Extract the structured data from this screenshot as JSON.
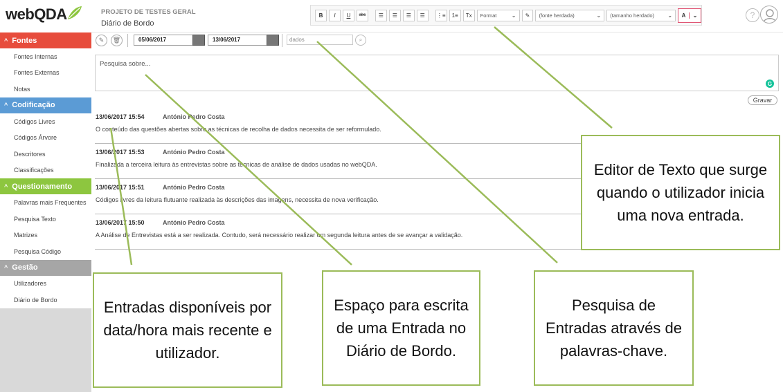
{
  "app": {
    "logo_web": "web",
    "logo_qda": "QDA"
  },
  "colors": {
    "fontes": "#e74c3c",
    "codificacao": "#5b9bd5",
    "questionamento": "#8dc63f",
    "gestao": "#a6a6a6",
    "callout_border": "#9bbb59",
    "connector": "#9bbb59"
  },
  "sidebar": {
    "sections": [
      {
        "title": "Fontes",
        "items": [
          "Fontes Internas",
          "Fontes Externas",
          "Notas"
        ]
      },
      {
        "title": "Codificação",
        "items": [
          "Códigos Livres",
          "Códigos Árvore",
          "Descritores",
          "Classificações"
        ]
      },
      {
        "title": "Questionamento",
        "items": [
          "Palavras mais Frequentes",
          "Pesquisa Texto",
          "Matrizes",
          "Pesquisa Código"
        ]
      },
      {
        "title": "Gestão",
        "items": [
          "Utilizadores",
          "Diário de Bordo"
        ]
      }
    ]
  },
  "header": {
    "project": "PROJETO DE TESTES GERAL",
    "page": "Diário de Bordo"
  },
  "toolbar": {
    "bold": "B",
    "italic": "I",
    "underline": "U",
    "strike": "abc",
    "format": "Format",
    "font": "(fonte herdada)",
    "size": "(tamanho herdado)",
    "color_letter": "A"
  },
  "filter": {
    "date_from": "05/06/2017",
    "date_to": "13/06/2017",
    "search_value": "dados"
  },
  "entry": {
    "placeholder": "Pesquisa sobre...",
    "save_label": "Gravar"
  },
  "entries": [
    {
      "datetime": "13/06/2017 15:54",
      "user": "António Pedro Costa",
      "text": "O conteúdo das questões abertas sobre as técnicas de recolha de dados necessita de ser reformulado."
    },
    {
      "datetime": "13/06/2017 15:53",
      "user": "António Pedro Costa",
      "text": "Finalizada a terceira leitura às entrevistas sobre as técnicas de análise de dados usadas no webQDA."
    },
    {
      "datetime": "13/06/2017 15:51",
      "user": "António Pedro Costa",
      "text": "Códigos livres da leitura flutuante realizada às descrições das imagens, necessita de nova verificação."
    },
    {
      "datetime": "13/06/2017 15:50",
      "user": "António Pedro Costa",
      "text": "A Análise de Entrevistas está a ser realizada. Contudo, será necessário realizar um segunda leitura antes de se avançar a validação."
    }
  ],
  "callouts": {
    "editor": "Editor de Texto que surge quando o utilizador inicia uma nova entrada.",
    "entries": "Entradas disponíveis por data/hora mais recente e utilizador.",
    "writing": "Espaço para escrita de uma Entrada no Diário de Bordo.",
    "search": "Pesquisa de Entradas através de palavras-chave."
  }
}
